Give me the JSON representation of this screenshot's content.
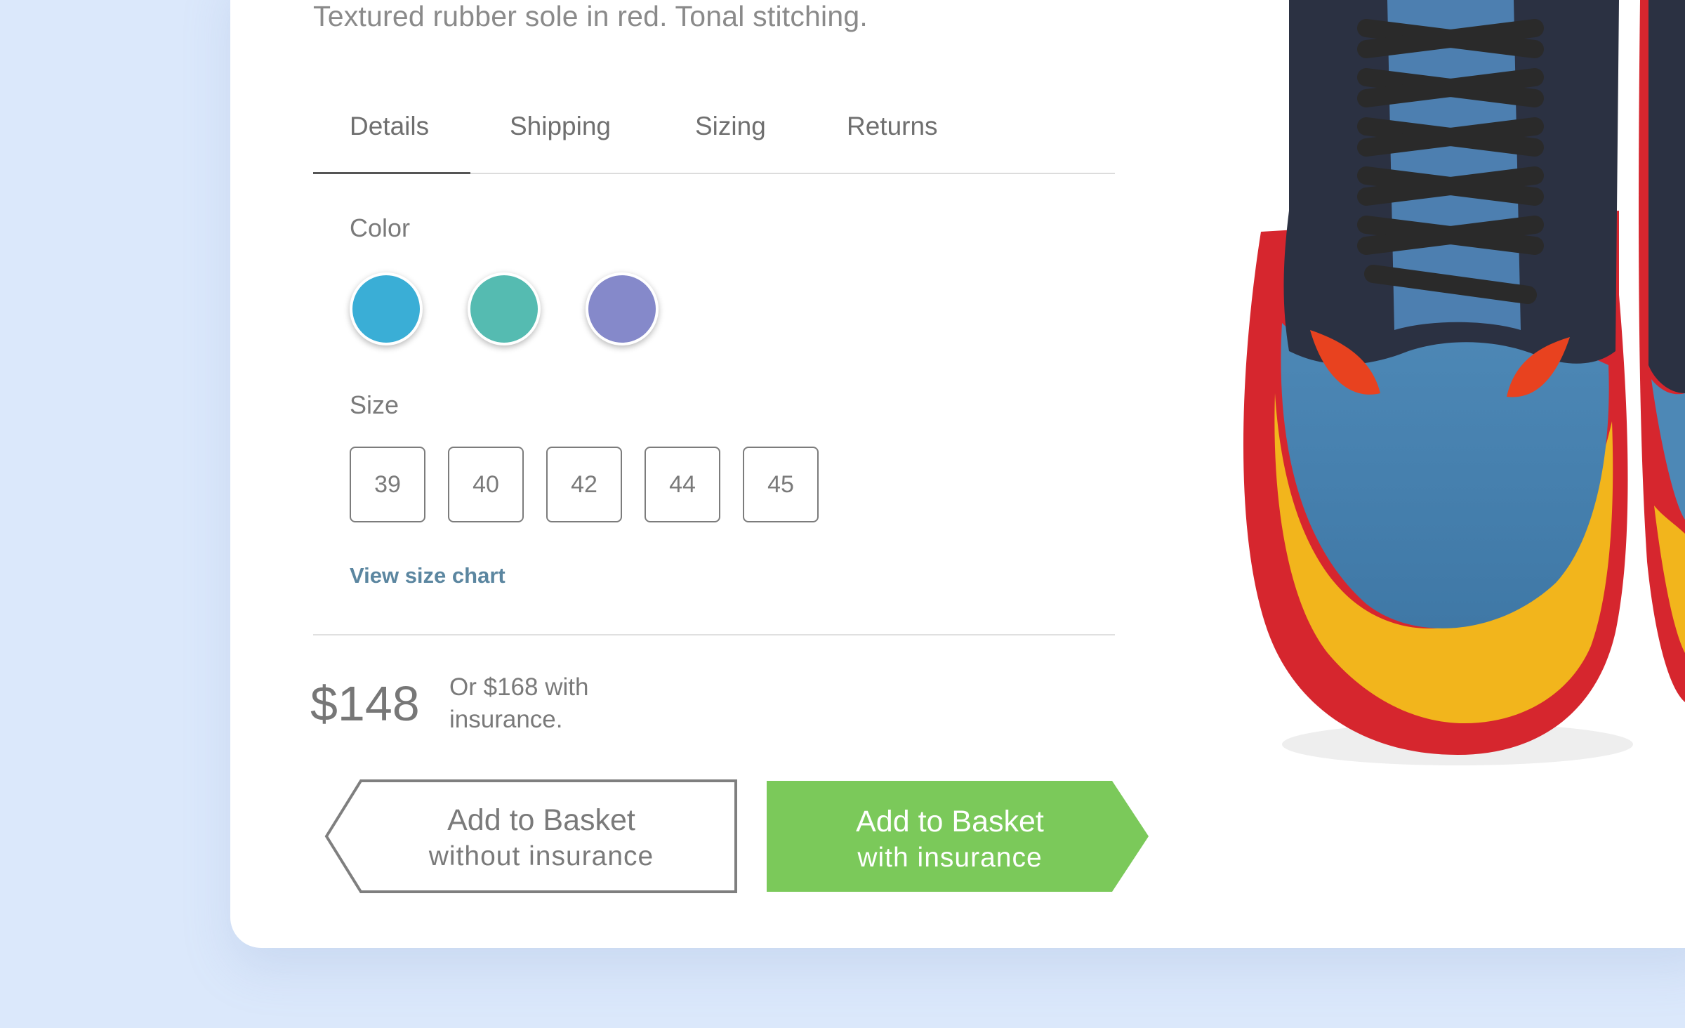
{
  "product": {
    "description": "Textured rubber sole in red. Tonal stitching."
  },
  "tabs": [
    {
      "label": "Details",
      "active": true
    },
    {
      "label": "Shipping",
      "active": false
    },
    {
      "label": "Sizing",
      "active": false
    },
    {
      "label": "Returns",
      "active": false
    }
  ],
  "color": {
    "label": "Color",
    "swatches": [
      "#3aaed6",
      "#55bbb1",
      "#8589ca"
    ]
  },
  "size": {
    "label": "Size",
    "options": [
      "39",
      "40",
      "42",
      "44",
      "45"
    ],
    "chart_link": "View size chart"
  },
  "price": {
    "amount": "$148",
    "note": "Or $168 with insurance."
  },
  "buttons": {
    "without_insurance": {
      "line1": "Add to Basket",
      "line2": "without insurance"
    },
    "with_insurance": {
      "line1": "Add to Basket",
      "line2": "with insurance"
    }
  },
  "colors": {
    "accent_green": "#7bc95a",
    "text_gray": "#7a7a7a",
    "link_blue": "#5b86a0",
    "background": "#dbe8fb"
  },
  "icons": {
    "product_image": "sneaker-image"
  }
}
